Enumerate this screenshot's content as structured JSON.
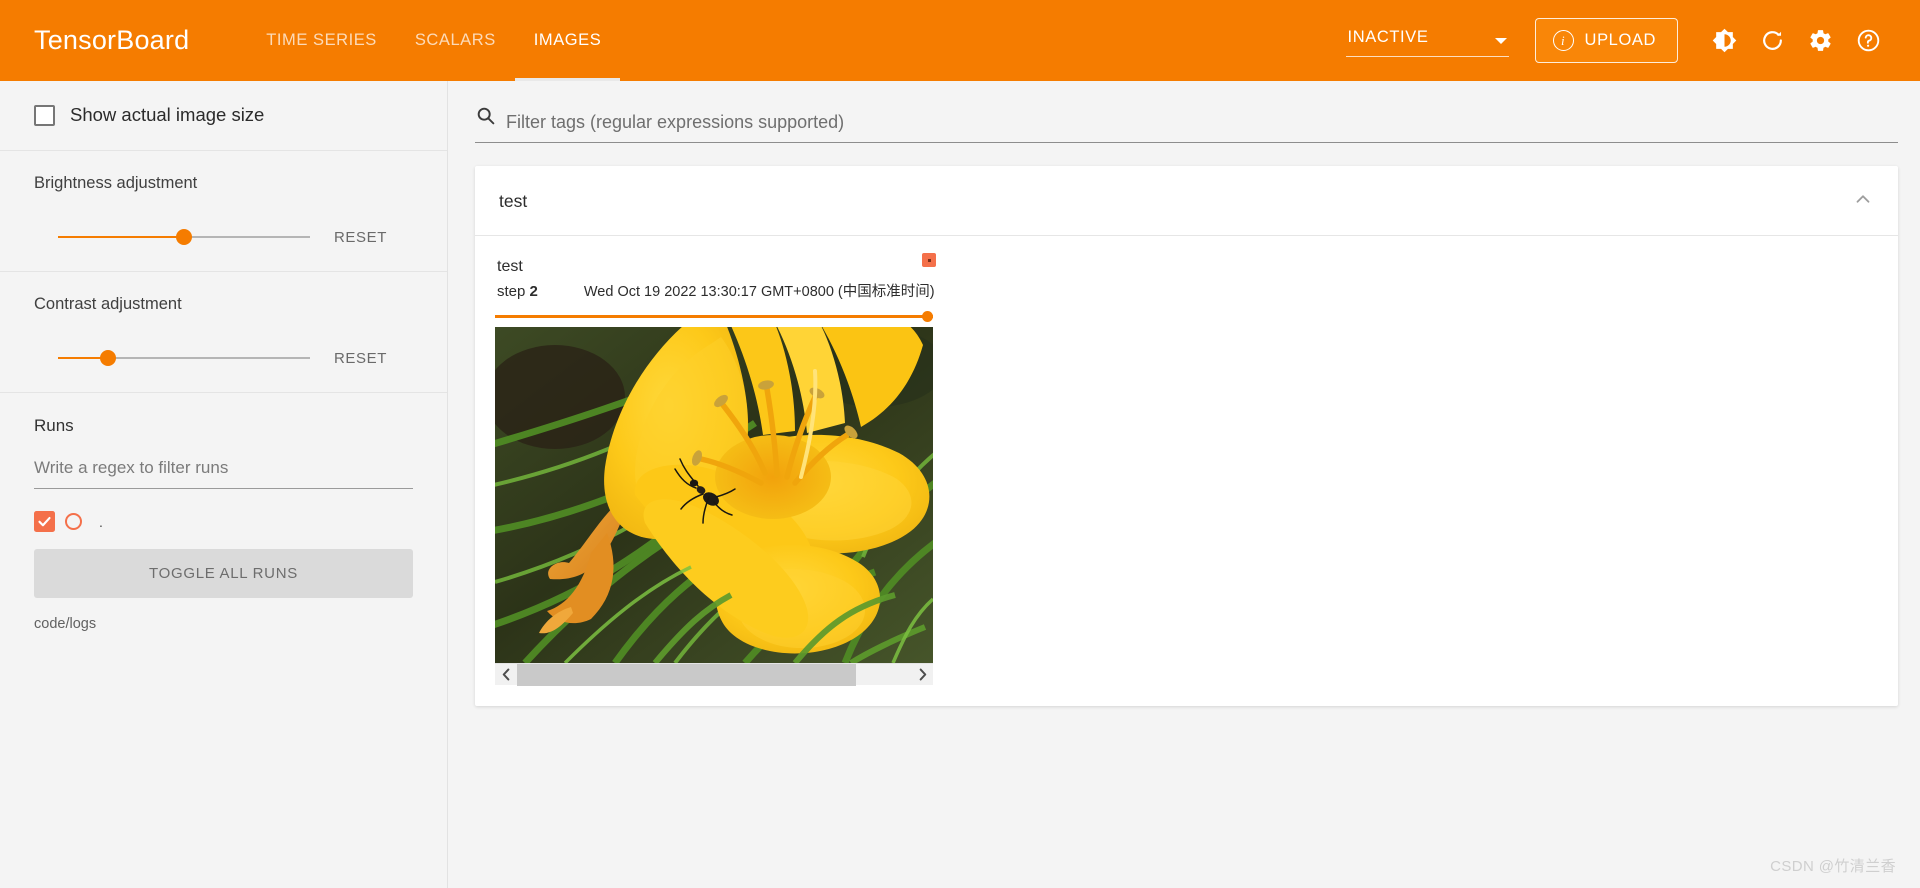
{
  "header": {
    "brand": "TensorBoard",
    "tabs": [
      {
        "label": "TIME SERIES",
        "active": false
      },
      {
        "label": "SCALARS",
        "active": false
      },
      {
        "label": "IMAGES",
        "active": true
      }
    ],
    "status": "INACTIVE",
    "upload_label": "UPLOAD",
    "icons": [
      "info-icon",
      "caret-down-icon",
      "brightness-icon",
      "refresh-icon",
      "settings-gear-icon",
      "help-question-icon"
    ],
    "accent_color": "#f57c00"
  },
  "sidebar": {
    "show_actual_size_label": "Show actual image size",
    "show_actual_size_checked": false,
    "brightness": {
      "title": "Brightness adjustment",
      "reset_label": "RESET",
      "value_pct": 50
    },
    "contrast": {
      "title": "Contrast adjustment",
      "reset_label": "RESET",
      "value_pct": 20
    },
    "runs": {
      "title": "Runs",
      "filter_placeholder": "Write a regex to filter runs",
      "filter_value": "",
      "items": [
        {
          "name": ".",
          "checked": true,
          "color": "#f4704a"
        }
      ],
      "toggle_all_label": "TOGGLE ALL RUNS",
      "log_path": "code/logs"
    }
  },
  "main": {
    "filter_placeholder": "Filter tags (regular expressions supported)",
    "filter_value": "",
    "tag_group": {
      "title": "test",
      "expanded": true,
      "cards": [
        {
          "tag": "test",
          "step_label": "step",
          "step_value": "2",
          "wall_time": "Wed Oct 19 2022 13:30:17 GMT+0800 (中国标准时间)",
          "run_color": "#f4704a",
          "image_alt": "yellow daylily flower with a black ant, green grass background",
          "slider_pct": 100
        }
      ]
    }
  },
  "watermark": "CSDN @竹清兰香"
}
